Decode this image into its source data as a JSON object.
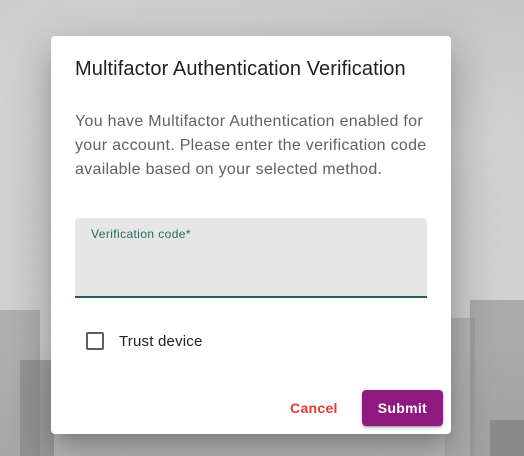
{
  "dialog": {
    "title": "Multifactor Authentication Verification",
    "message": "You have Multifactor Authentication enabled for your account. Please enter the verification code available based on your selected method.",
    "verification_field": {
      "label": "Verification code*",
      "value": "",
      "placeholder": ""
    },
    "trust_device": {
      "label": "Trust device",
      "checked": false
    },
    "actions": {
      "cancel_label": "Cancel",
      "submit_label": "Submit"
    }
  },
  "colors": {
    "accent": "#8e1a7f",
    "cancel": "#e53935",
    "field_underline": "#1f5f5c"
  }
}
